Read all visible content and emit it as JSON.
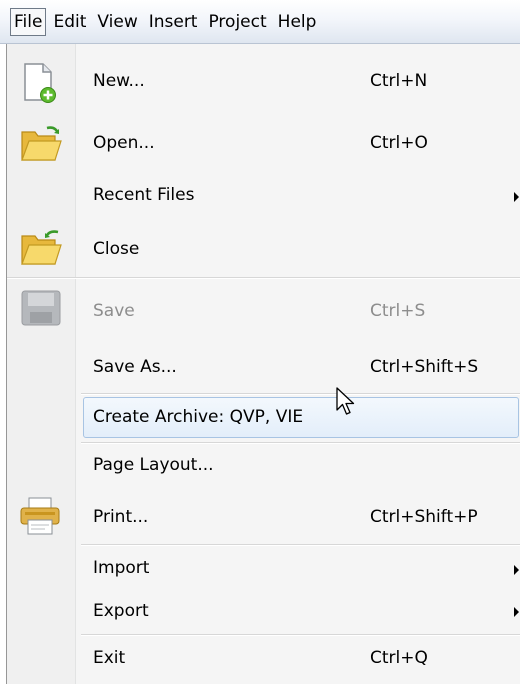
{
  "menubar": {
    "items": [
      "File",
      "Edit",
      "View",
      "Insert",
      "Project",
      "Help"
    ]
  },
  "file_menu": {
    "new": {
      "label": "New...",
      "shortcut": "Ctrl+N",
      "icon": "new-document-icon"
    },
    "open": {
      "label": "Open...",
      "shortcut": "Ctrl+O",
      "icon": "open-folder-icon"
    },
    "recent": {
      "label": "Recent Files",
      "submenu": true
    },
    "close": {
      "label": "Close",
      "icon": "close-folder-icon"
    },
    "save": {
      "label": "Save",
      "shortcut": "Ctrl+S",
      "icon": "save-disk-icon",
      "disabled": true
    },
    "save_as": {
      "label": "Save As...",
      "shortcut": "Ctrl+Shift+S"
    },
    "archive": {
      "label": "Create Archive: QVP, VIE",
      "highlighted": true
    },
    "page_layout": {
      "label": "Page Layout..."
    },
    "print": {
      "label": "Print...",
      "shortcut": "Ctrl+Shift+P",
      "icon": "printer-icon"
    },
    "import": {
      "label": "Import",
      "submenu": true
    },
    "export": {
      "label": "Export",
      "submenu": true
    },
    "exit": {
      "label": "Exit",
      "shortcut": "Ctrl+Q"
    }
  },
  "colors": {
    "highlight_border": "#a8c4e3",
    "highlight_fill": "#e3eefa",
    "disabled_text": "#8d8d8d"
  }
}
